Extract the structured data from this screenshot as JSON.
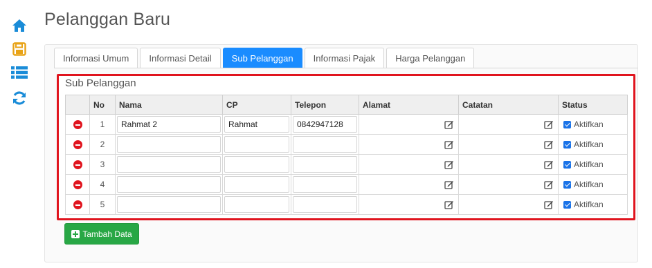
{
  "page": {
    "title": "Pelanggan Baru"
  },
  "sidebar": {
    "icons": [
      "home-icon",
      "save-icon",
      "list-icon",
      "refresh-icon"
    ],
    "colors": {
      "home": "#1a8cd8",
      "save": "#e8a317",
      "list": "#1a8cd8",
      "refresh": "#1a8cd8"
    }
  },
  "tabs": [
    {
      "label": "Informasi Umum",
      "active": false
    },
    {
      "label": "Informasi Detail",
      "active": false
    },
    {
      "label": "Sub Pelanggan",
      "active": true
    },
    {
      "label": "Informasi Pajak",
      "active": false
    },
    {
      "label": "Harga Pelanggan",
      "active": false
    }
  ],
  "section": {
    "title": "Sub Pelanggan",
    "columns": [
      "No",
      "Nama",
      "CP",
      "Telepon",
      "Alamat",
      "Catatan",
      "Status"
    ],
    "rows": [
      {
        "no": "1",
        "nama": "Rahmat 2",
        "cp": "Rahmat",
        "telepon": "0842947128",
        "status": "Aktifkan"
      },
      {
        "no": "2",
        "nama": "",
        "cp": "",
        "telepon": "",
        "status": "Aktifkan"
      },
      {
        "no": "3",
        "nama": "",
        "cp": "",
        "telepon": "",
        "status": "Aktifkan"
      },
      {
        "no": "4",
        "nama": "",
        "cp": "",
        "telepon": "",
        "status": "Aktifkan"
      },
      {
        "no": "5",
        "nama": "",
        "cp": "",
        "telepon": "",
        "status": "Aktifkan"
      }
    ]
  },
  "actions": {
    "add_label": "Tambah Data"
  },
  "colors": {
    "accent": "#1a8cff",
    "highlight_border": "#e0141e",
    "add_button": "#28a745",
    "delete": "#e0141e"
  }
}
